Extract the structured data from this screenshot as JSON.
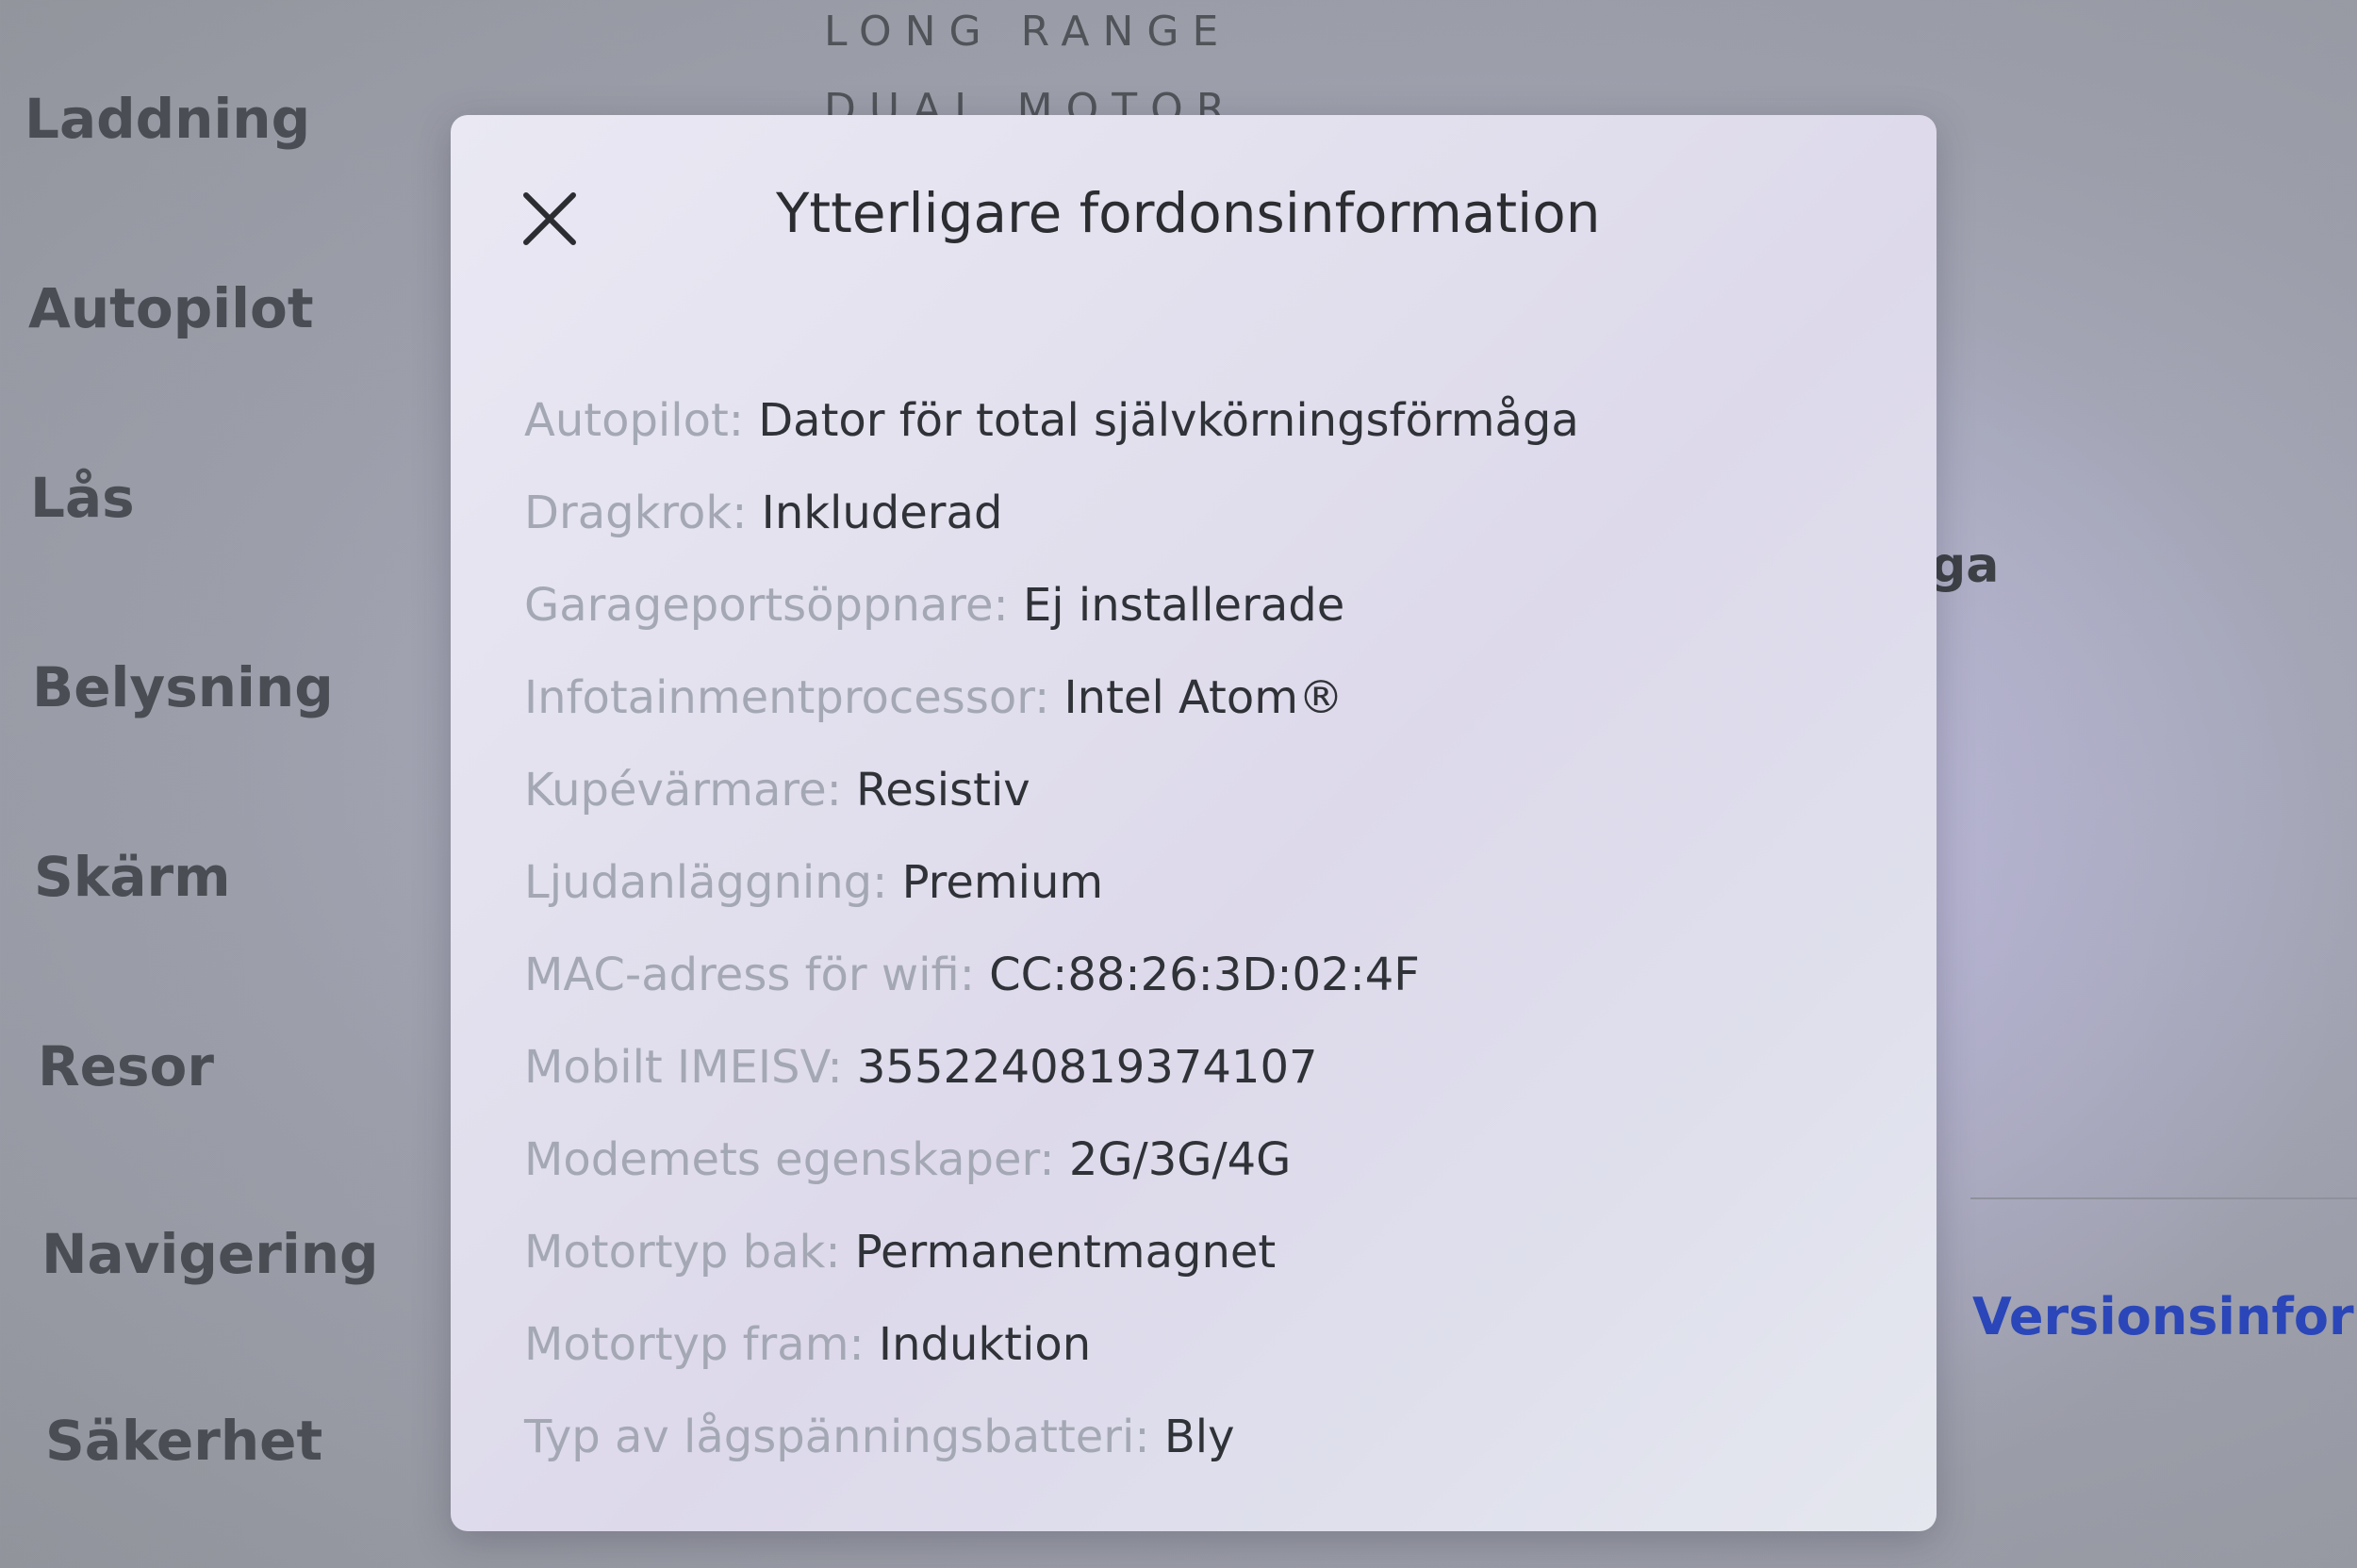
{
  "background": {
    "model_line_1": "LONG RANGE",
    "model_line_2": "DUAL MOTOR",
    "partial_text": "ga",
    "version_link": "Versionsinforma"
  },
  "sidebar": {
    "items": [
      {
        "label": "Laddning"
      },
      {
        "label": "Autopilot"
      },
      {
        "label": "Lås"
      },
      {
        "label": "Belysning"
      },
      {
        "label": "Skärm"
      },
      {
        "label": "Resor"
      },
      {
        "label": "Navigering"
      },
      {
        "label": "Säkerhet"
      }
    ]
  },
  "modal": {
    "close_icon": "close-icon",
    "title": "Ytterligare fordonsinformation",
    "rows": [
      {
        "label": "Autopilot:",
        "value": "Dator för total självkörningsförmåga"
      },
      {
        "label": "Dragkrok:",
        "value": "Inkluderad"
      },
      {
        "label": "Garageportsöppnare:",
        "value": "Ej installerade"
      },
      {
        "label": "Infotainmentprocessor:",
        "value": "Intel Atom®"
      },
      {
        "label": "Kupévärmare:",
        "value": "Resistiv"
      },
      {
        "label": "Ljudanläggning:",
        "value": "Premium"
      },
      {
        "label": "MAC-adress för wifi:",
        "value": "CC:88:26:3D:02:4F"
      },
      {
        "label": "Mobilt IMEISV:",
        "value": "3552240819374107"
      },
      {
        "label": "Modemets egenskaper:",
        "value": "2G/3G/4G"
      },
      {
        "label": "Motortyp bak:",
        "value": "Permanentmagnet"
      },
      {
        "label": "Motortyp fram:",
        "value": "Induktion"
      },
      {
        "label": "Typ av lågspänningsbatteri:",
        "value": "Bly"
      }
    ]
  },
  "colors": {
    "link": "#2a46b8",
    "label": "#a4a8b5",
    "value": "#2f3237"
  }
}
